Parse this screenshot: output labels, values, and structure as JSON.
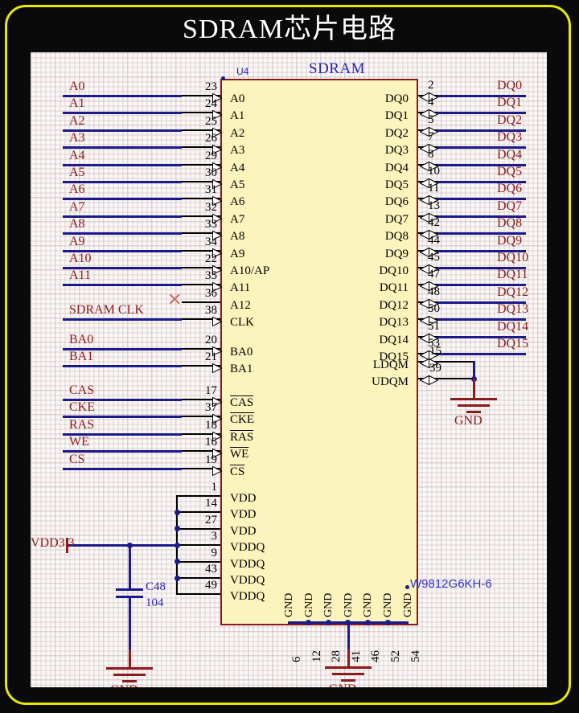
{
  "title": "SDRAM芯片电路",
  "chip": {
    "refdes": "U4",
    "name": "SDRAM",
    "part_number": "W9812G6KH-6",
    "body_color": "#fbf4bd",
    "border_color": "#8b1a1a"
  },
  "colors": {
    "frame": "#e8e800",
    "background": "#0a0a0a",
    "sheet": "#faf8f6",
    "wire_blue": "#1a1a8c",
    "wire_black": "#000000",
    "net_label": "#8b1a1a",
    "blue_text": "#2222bb"
  },
  "address_bus": [
    {
      "net": "A0",
      "pin": "23",
      "name": "A0"
    },
    {
      "net": "A1",
      "pin": "24",
      "name": "A1"
    },
    {
      "net": "A2",
      "pin": "25",
      "name": "A2"
    },
    {
      "net": "A3",
      "pin": "26",
      "name": "A3"
    },
    {
      "net": "A4",
      "pin": "29",
      "name": "A4"
    },
    {
      "net": "A5",
      "pin": "30",
      "name": "A5"
    },
    {
      "net": "A6",
      "pin": "31",
      "name": "A6"
    },
    {
      "net": "A7",
      "pin": "32",
      "name": "A7"
    },
    {
      "net": "A8",
      "pin": "33",
      "name": "A8"
    },
    {
      "net": "A9",
      "pin": "34",
      "name": "A9"
    },
    {
      "net": "A10",
      "pin": "22",
      "name": "A10/AP"
    },
    {
      "net": "A11",
      "pin": "35",
      "name": "A11"
    },
    {
      "net": "",
      "pin": "36",
      "name": "A12"
    },
    {
      "net": "SDRAM_CLK",
      "pin": "38",
      "name": "CLK"
    }
  ],
  "clk_net_label": "SDRAM  CLK",
  "bank_bus": [
    {
      "net": "BA0",
      "pin": "20",
      "name": "BA0"
    },
    {
      "net": "BA1",
      "pin": "21",
      "name": "BA1"
    }
  ],
  "control_bus": [
    {
      "net": "CAS",
      "pin": "17",
      "name": "CAS",
      "overline": true
    },
    {
      "net": "CKE",
      "pin": "37",
      "name": "CKE",
      "overline": true
    },
    {
      "net": "RAS",
      "pin": "18",
      "name": "RAS",
      "overline": true
    },
    {
      "net": "WE",
      "pin": "16",
      "name": "WE",
      "overline": true
    },
    {
      "net": "CS",
      "pin": "19",
      "name": "CS",
      "overline": true
    }
  ],
  "power_pins": [
    {
      "pin": "1",
      "name": "VDD"
    },
    {
      "pin": "14",
      "name": "VDD"
    },
    {
      "pin": "27",
      "name": "VDD"
    },
    {
      "pin": "3",
      "name": "VDDQ"
    },
    {
      "pin": "9",
      "name": "VDDQ"
    },
    {
      "pin": "43",
      "name": "VDDQ"
    },
    {
      "pin": "49",
      "name": "VDDQ"
    }
  ],
  "data_bus": [
    {
      "net": "DQ0",
      "pin": "2",
      "name": "DQ0"
    },
    {
      "net": "DQ1",
      "pin": "4",
      "name": "DQ1"
    },
    {
      "net": "DQ2",
      "pin": "5",
      "name": "DQ2"
    },
    {
      "net": "DQ3",
      "pin": "7",
      "name": "DQ3"
    },
    {
      "net": "DQ4",
      "pin": "8",
      "name": "DQ4"
    },
    {
      "net": "DQ5",
      "pin": "10",
      "name": "DQ5"
    },
    {
      "net": "DQ6",
      "pin": "11",
      "name": "DQ6"
    },
    {
      "net": "DQ7",
      "pin": "13",
      "name": "DQ7"
    },
    {
      "net": "DQ8",
      "pin": "42",
      "name": "DQ8"
    },
    {
      "net": "DQ9",
      "pin": "44",
      "name": "DQ9"
    },
    {
      "net": "DQ10",
      "pin": "45",
      "name": "DQ10"
    },
    {
      "net": "DQ11",
      "pin": "47",
      "name": "DQ11"
    },
    {
      "net": "DQ12",
      "pin": "48",
      "name": "DQ12"
    },
    {
      "net": "DQ13",
      "pin": "50",
      "name": "DQ13"
    },
    {
      "net": "DQ14",
      "pin": "51",
      "name": "DQ14"
    },
    {
      "net": "DQ15",
      "pin": "53",
      "name": "DQ15"
    }
  ],
  "dqm_pins": [
    {
      "pin": "15",
      "name": "LDQM"
    },
    {
      "pin": "39",
      "name": "UDQM"
    }
  ],
  "ground_pins": [
    {
      "pin": "6",
      "name": "GND"
    },
    {
      "pin": "12",
      "name": "GND"
    },
    {
      "pin": "28",
      "name": "GND"
    },
    {
      "pin": "41",
      "name": "GND"
    },
    {
      "pin": "46",
      "name": "GND"
    },
    {
      "pin": "52",
      "name": "GND"
    },
    {
      "pin": "54",
      "name": "GND"
    }
  ],
  "power_port": {
    "label": "VDD3.3"
  },
  "capacitor": {
    "refdes": "C48",
    "value": "104"
  },
  "gnd_labels": {
    "dqm": "GND",
    "cap": "GND",
    "chip": "GND"
  }
}
